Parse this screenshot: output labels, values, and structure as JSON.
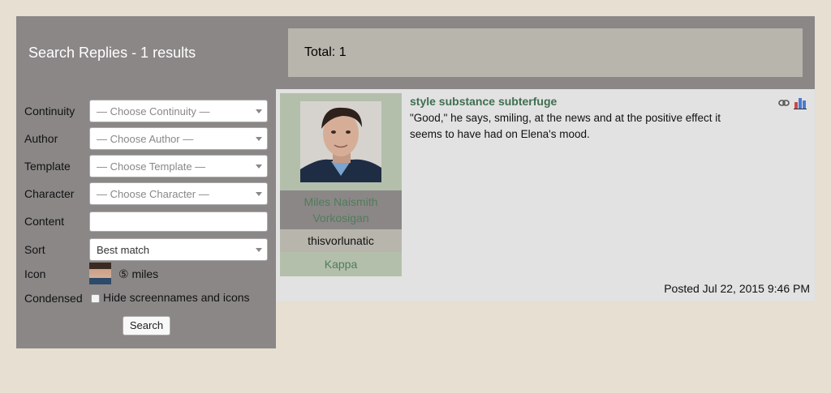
{
  "header": {
    "title": "Search Replies - 1 results",
    "total": "Total: 1"
  },
  "filters": {
    "continuity": {
      "label": "Continuity",
      "placeholder": "— Choose Continuity —"
    },
    "author": {
      "label": "Author",
      "placeholder": "— Choose Author —"
    },
    "template": {
      "label": "Template",
      "placeholder": "— Choose Template —"
    },
    "character": {
      "label": "Character",
      "placeholder": "— Choose Character —"
    },
    "content": {
      "label": "Content",
      "value": ""
    },
    "sort": {
      "label": "Sort",
      "value": "Best match"
    },
    "icon": {
      "label": "Icon",
      "value": "⑤ miles"
    },
    "condensed": {
      "label": "Condensed",
      "option": "Hide screennames and icons",
      "checked": false
    },
    "search_label": "Search"
  },
  "result": {
    "character_name": "Miles Naismith Vorkosigan",
    "screenname": "thisvorlunatic",
    "continuity": "Kappa",
    "title": "style substance subterfuge",
    "body": "\"Good,\" he says, smiling, at the news and at the positive effect it seems to have had on Elena's mood.",
    "posted": "Posted Jul 22, 2015 9:46 PM",
    "icons": [
      "link-icon",
      "bar-chart-icon"
    ]
  },
  "colors": {
    "page_bg": "#e6dfd2",
    "panel_bg": "#8b8787",
    "accent_green": "#4f7d5a",
    "title_green": "#3f6e50"
  }
}
